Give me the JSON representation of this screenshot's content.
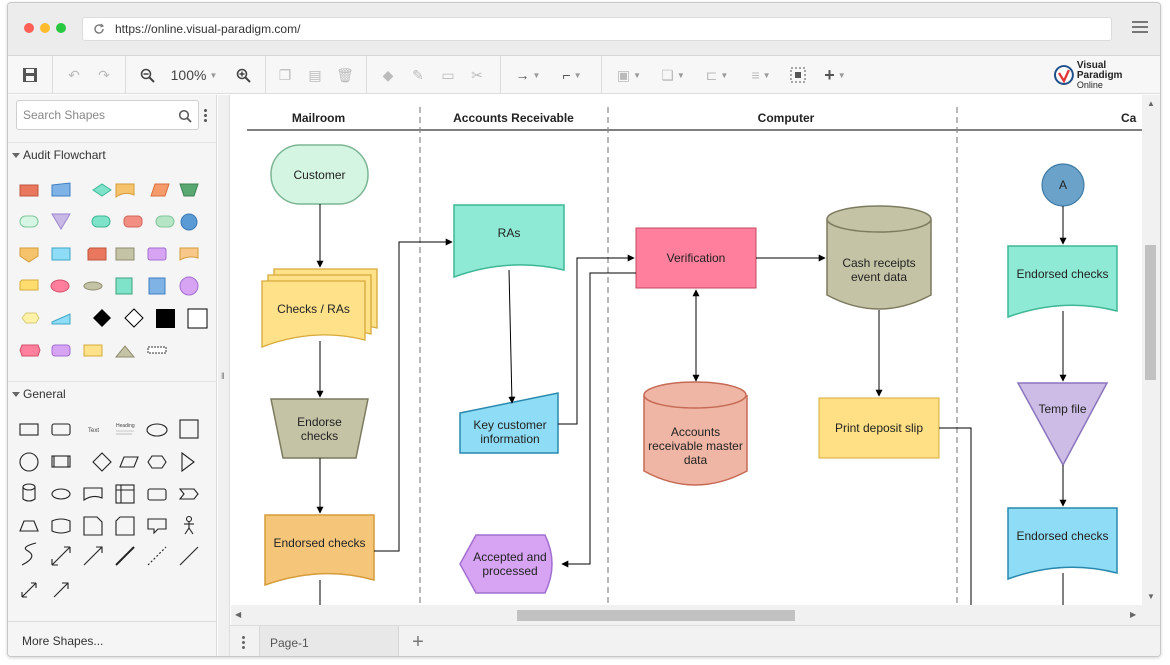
{
  "browser": {
    "url": "https://online.visual-paradigm.com/"
  },
  "toolbar": {
    "zoom": "100%"
  },
  "logo": {
    "line1": "Visual Paradigm",
    "line2": "Online"
  },
  "sidebar": {
    "search_placeholder": "Search Shapes",
    "sections": [
      {
        "title": "Audit Flowchart"
      },
      {
        "title": "General"
      }
    ],
    "general_text_labels": {
      "text": "Text",
      "heading": "Heading"
    },
    "more_shapes": "More Shapes..."
  },
  "lanes": [
    {
      "name": "Mailroom"
    },
    {
      "name": "Accounts Receivable"
    },
    {
      "name": "Computer"
    },
    {
      "name": "Ca"
    }
  ],
  "nodes": {
    "customer": "Customer",
    "checks_ras": "Checks / RAs",
    "endorse_checks": "Endorse checks",
    "endorsed_checks_1": "Endorsed checks",
    "ras": "RAs",
    "key_customer_info": "Key customer information",
    "accepted_processed": "Accepted and processed",
    "verification": "Verification",
    "ar_master_data": "Accounts receivable master data",
    "cash_receipts": "Cash receipts event data",
    "print_deposit_slip": "Print deposit slip",
    "connector_a": "A",
    "endorsed_checks_2": "Endorsed checks",
    "temp_file": "Temp file",
    "endorsed_checks_3": "Endorsed checks"
  },
  "pages": {
    "current": "Page-1"
  },
  "colors": {
    "mint": "#8eead4",
    "green_light": "#d5f5e3",
    "yellow": "#ffe18a",
    "khaki": "#c5c3a6",
    "orange": "#f5c67a",
    "pink": "#ff7f9d",
    "salmon": "#f0b6a5",
    "blue": "#8edcf5",
    "purple": "#d6a4f3",
    "lavender": "#cdbde6",
    "steel": "#6aa2c9",
    "deposit_yellow": "#ffe085"
  }
}
